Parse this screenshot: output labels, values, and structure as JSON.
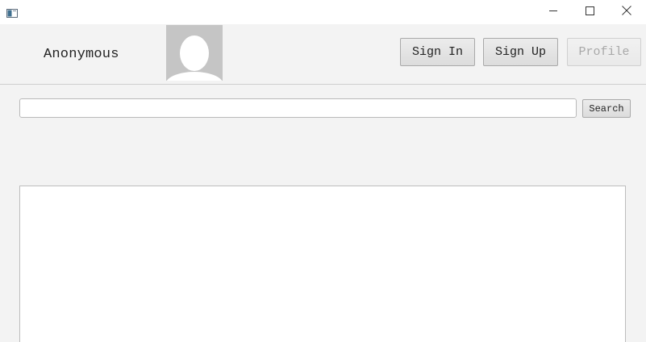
{
  "window": {
    "icon": "app-window-icon",
    "controls": {
      "minimize": "minimize-icon",
      "maximize": "maximize-icon",
      "close": "close-icon"
    }
  },
  "header": {
    "username": "Anonymous",
    "avatar_icon": "default-avatar-icon",
    "sign_in_label": "Sign In",
    "sign_up_label": "Sign Up",
    "profile_label": "Profile",
    "profile_enabled": false
  },
  "search": {
    "value": "",
    "placeholder": "",
    "button_label": "Search"
  },
  "colors": {
    "background": "#f3f3f3",
    "avatar_bg": "#c5c5c5",
    "disabled_text": "#a8a8a8"
  }
}
